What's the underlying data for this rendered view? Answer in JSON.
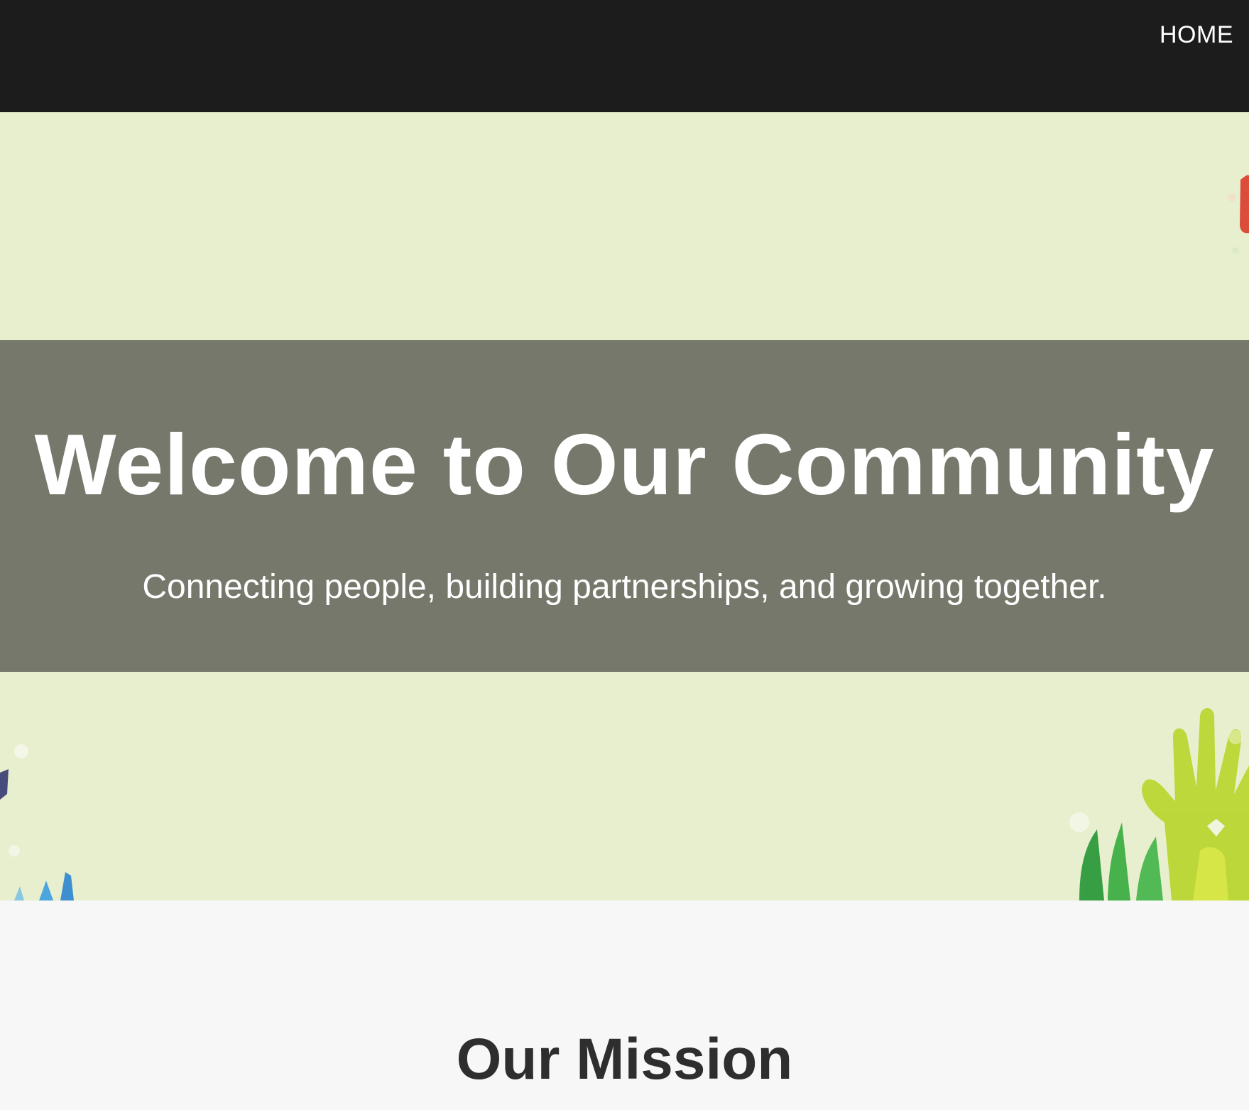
{
  "nav": {
    "home_label": "HOME"
  },
  "hero": {
    "title": "Welcome to Our Community",
    "subtitle": "Connecting people, building partnerships, and growing together."
  },
  "mission": {
    "title": "Our Mission"
  },
  "colors": {
    "topbar": "#1c1c1c",
    "hero_background": "#e8efce",
    "hero_overlay": "#75786a",
    "mission_background": "#f7f7f7",
    "heading_text": "#2e2e2e"
  },
  "icons": [
    "raised-hands-illustration"
  ]
}
